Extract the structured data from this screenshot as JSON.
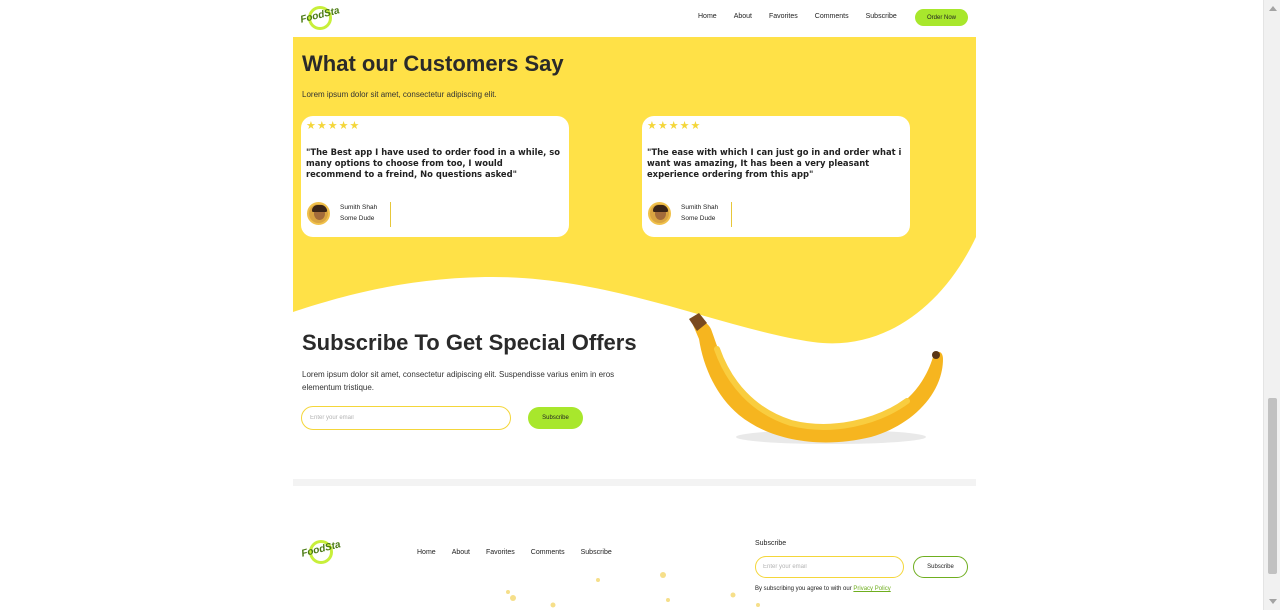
{
  "navbar": {
    "logo_text": "FoodSta",
    "links": [
      "Home",
      "About",
      "Favorites",
      "Comments",
      "Subscribe"
    ],
    "order_button": "Order Now"
  },
  "testimonials": {
    "title": "What our Customers Say",
    "subtitle": "Lorem ipsum dolor sit amet, consectetur adipiscing elit.",
    "cards": [
      {
        "stars": "★★★★★",
        "quote": "\"The Best app I have used to order food in a while, so many options to choose from too, I would recommend to a freind, No questions asked\"",
        "name": "Sumith Shah",
        "role": "Some Dude"
      },
      {
        "stars": "★★★★★",
        "quote": "\"The ease with which I can just go in and order what i want was amazing, It has been a very pleasant experience ordering from this app\"",
        "name": "Sumith Shah",
        "role": "Some Dude"
      }
    ]
  },
  "subscribe": {
    "title": "Subscribe To Get Special Offers",
    "text": "Lorem ipsum dolor sit amet, consectetur adipiscing elit. Suspendisse varius enim in eros elementum tristique.",
    "input_placeholder": "Enter your email",
    "button": "Subscribe"
  },
  "footer": {
    "logo_text": "FoodSta",
    "links": [
      "Home",
      "About",
      "Favorites",
      "Comments",
      "Subscribe"
    ],
    "subscribe_label": "Subscribe",
    "input_placeholder": "Enter your email",
    "button": "Subscribe",
    "note": "By subscribing you agree to with our ",
    "privacy_link": "Privacy Policy"
  },
  "colors": {
    "yellow": "#ffe147",
    "accent_green": "#a8e72c",
    "star": "#f4d63a"
  }
}
